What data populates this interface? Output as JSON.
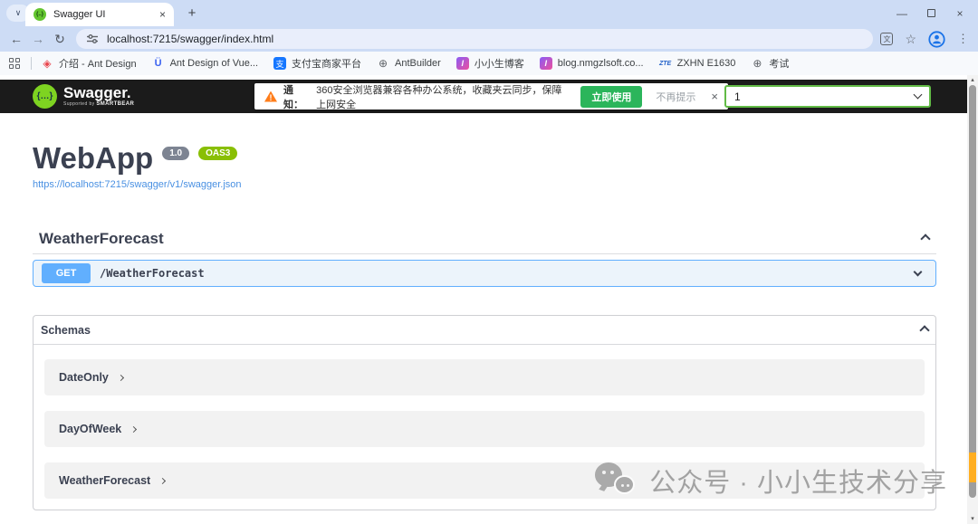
{
  "colors": {
    "chrome_blue": "#cddcf5",
    "topbar_bg": "#1b1b1b",
    "get_method_blue": "#61affe",
    "oas3_green": "#89bf04",
    "version_badge_gray": "#7d8492",
    "notice_button_green": "#2bb55b",
    "link_blue": "#4990e2",
    "select_border_green": "#62bb46",
    "scroll_marker_orange": "#ffae21"
  },
  "icons": {
    "tab_search": "∨",
    "tab_close": "×",
    "new_tab": "+",
    "minimize": "—",
    "window_close": "×",
    "back": "←",
    "forward": "→",
    "reload": "↻",
    "translate": "文",
    "star": "☆",
    "menu": "⋮",
    "warn": "!",
    "notice_close": "×",
    "scroll_up": "▴",
    "scroll_down": "▾",
    "favicon_braces": "{..}",
    "logo_braces": "{…}"
  },
  "browser": {
    "tab_title": "Swagger UI",
    "url": "localhost:7215/swagger/index.html",
    "bookmarks": [
      {
        "label": "介绍 - Ant Design",
        "icon": "ant-design",
        "glyph": "◈"
      },
      {
        "label": "Ant Design of Vue...",
        "icon": "ant-design-vue",
        "glyph": "Ü"
      },
      {
        "label": "支付宝商家平台",
        "icon": "alipay",
        "glyph": "支"
      },
      {
        "label": "AntBuilder",
        "icon": "globe",
        "glyph": "⊕"
      },
      {
        "label": "小小生博客",
        "icon": "blog",
        "glyph": "I"
      },
      {
        "label": "blog.nmgzlsoft.co...",
        "icon": "blog",
        "glyph": "I"
      },
      {
        "label": "ZXHN E1630",
        "icon": "zte",
        "glyph": "ZTE"
      },
      {
        "label": "考试",
        "icon": "globe",
        "glyph": "⊕"
      }
    ]
  },
  "topbar": {
    "logo_text": "Swagger.",
    "supported_by": "Supported by",
    "smartbear": "SMARTBEAR",
    "notice_label": "通知：",
    "notice_text": "360安全浏览器兼容各种办公系统，收藏夹云同步，保障上网安全",
    "notice_action": "立即使用",
    "notice_dismiss": "不再提示",
    "version_selected": "1"
  },
  "api": {
    "title": "WebApp",
    "version_badge": "1.0",
    "oas_badge": "OAS3",
    "spec_link": "https://localhost:7215/swagger/v1/swagger.json"
  },
  "tag_section": {
    "name": "WeatherForecast",
    "operations": [
      {
        "method": "GET",
        "path": "/WeatherForecast"
      }
    ]
  },
  "schemas": {
    "heading": "Schemas",
    "models": [
      "DateOnly",
      "DayOfWeek",
      "WeatherForecast"
    ]
  },
  "watermark": {
    "text": "公众号 · 小小生技术分享"
  }
}
